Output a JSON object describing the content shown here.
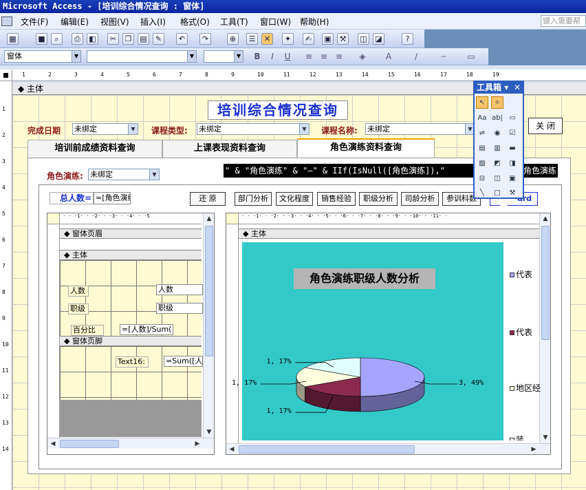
{
  "window": {
    "title": "Microsoft Access - [培训综合情况查询 : 窗体]"
  },
  "menu": {
    "items": [
      "文件(F)",
      "编辑(E)",
      "视图(V)",
      "插入(I)",
      "格式(O)",
      "工具(T)",
      "窗口(W)",
      "帮助(H)"
    ],
    "help_placeholder": "键入需要帮"
  },
  "format_toolbar": {
    "object_combo": "窗体",
    "bold": "B",
    "italic": "I",
    "underline": "U"
  },
  "design": {
    "ruler_marks": [
      "1",
      "2",
      "3",
      "4",
      "5",
      "6",
      "7",
      "8",
      "9",
      "10",
      "11",
      "12",
      "13",
      "14",
      "15",
      "16",
      "17",
      "18",
      "19"
    ],
    "vruler_marks": [
      "1",
      "2",
      "3",
      "4",
      "5",
      "6",
      "7",
      "8",
      "9",
      "10",
      "11",
      "12",
      "13",
      "14"
    ],
    "section_main": "主体"
  },
  "form": {
    "title": "培训综合情况查询",
    "filters": [
      {
        "label": "完成日期",
        "value": "未绑定"
      },
      {
        "label": "课程类型:",
        "value": "未绑定"
      },
      {
        "label": "课程名称:",
        "value": "未绑定"
      }
    ],
    "close_button": "关 闭",
    "tabs": [
      "培训前成绩资料查询",
      "上课表现资料查询",
      "角色演练资料查询"
    ],
    "active_tab": 2,
    "role_label": "角色演练:",
    "role_value": "未绑定",
    "formula": "\" & \"角色演练\" & \"—\" & IIf(IsNull([角色演练]),\"",
    "formula_tail": "角色演练",
    "total_label": "总人数=",
    "total_value": "=[角色演练]",
    "buttons": [
      "还 原",
      "部门分析",
      "文化程度",
      "销售经验",
      "职级分析",
      "司龄分析",
      "参训科数"
    ],
    "wizard_button": "ard"
  },
  "subform_left": {
    "section_header": "窗体页眉",
    "section_main": "主体",
    "section_footer": "窗体页脚",
    "controls": {
      "label_count": "人数",
      "field_count": "人数",
      "label_rank": "职级",
      "field_rank": "职级",
      "label_pct": "百分比",
      "field_pct": "=[人数]/Sum(",
      "label_text16": "Text16:",
      "field_sum": "=Sum([人数"
    }
  },
  "subform_right": {
    "section_main": "主体"
  },
  "chart_data": {
    "type": "pie",
    "title": "角色演练职级人数分析",
    "slices": [
      {
        "label": "3, 49%",
        "value": 3,
        "percent": 49,
        "color": "#a5a5ff"
      },
      {
        "label": "1, 17%",
        "value": 1,
        "percent": 17,
        "color": "#8b2a4f"
      },
      {
        "label": "1, 17%",
        "value": 1,
        "percent": 17,
        "color": "#ffffe0"
      },
      {
        "label": "1, 17%",
        "value": 1,
        "percent": 17,
        "color": "#e0ffff"
      }
    ],
    "legend": [
      "代表",
      "代表",
      "地区经",
      "装"
    ],
    "legend_colors": [
      "#a5a5ff",
      "#8b2a4f",
      "#ffffe0",
      "#e0ffff"
    ]
  },
  "toolbox": {
    "title": "工具箱"
  }
}
